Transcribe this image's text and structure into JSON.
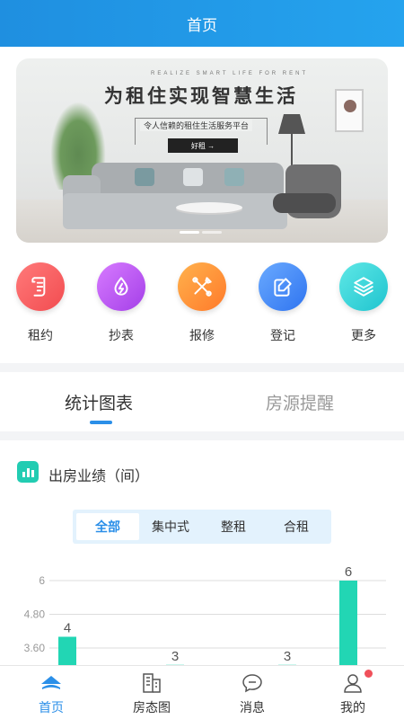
{
  "header": {
    "title": "首页"
  },
  "banner": {
    "small_caps": "REALIZE SMART LIFE FOR RENT",
    "title": "为租住实现智慧生活",
    "subtitle": "令人信赖的租住生活服务平台",
    "button_label": "好租 →"
  },
  "quick_actions": [
    {
      "label": "租约",
      "icon": "contract-icon",
      "color_from": "#ff7a7a",
      "color_to": "#f24c50"
    },
    {
      "label": "抄表",
      "icon": "meter-drop-icon",
      "color_from": "#d77bff",
      "color_to": "#a43fe8"
    },
    {
      "label": "报修",
      "icon": "repair-tools-icon",
      "color_from": "#ffb24d",
      "color_to": "#ff7a2a"
    },
    {
      "label": "登记",
      "icon": "register-edit-icon",
      "color_from": "#6aaaff",
      "color_to": "#2f74f0"
    },
    {
      "label": "更多",
      "icon": "layers-icon",
      "color_from": "#5fe8e6",
      "color_to": "#1fc4cf"
    }
  ],
  "tabs": [
    {
      "label": "统计图表",
      "active": true
    },
    {
      "label": "房源提醒",
      "active": false
    }
  ],
  "chart_section": {
    "title": "出房业绩（间）",
    "filters": [
      {
        "label": "全部",
        "active": true
      },
      {
        "label": "集中式",
        "active": false
      },
      {
        "label": "整租",
        "active": false
      },
      {
        "label": "合租",
        "active": false
      }
    ]
  },
  "chart_data": {
    "type": "bar",
    "title": "出房业绩（间）",
    "yticks": [
      "6",
      "4.80",
      "3.60"
    ],
    "ylim": [
      0,
      6
    ],
    "values": [
      4,
      3,
      3,
      6
    ],
    "value_labels": [
      "4",
      "3",
      "3",
      "6"
    ],
    "bar_color": "#22d6b4",
    "grid": true
  },
  "tabbar": [
    {
      "label": "首页",
      "icon": "home-icon",
      "active": true,
      "badge": false
    },
    {
      "label": "房态图",
      "icon": "building-icon",
      "active": false,
      "badge": false
    },
    {
      "label": "消息",
      "icon": "message-icon",
      "active": false,
      "badge": false
    },
    {
      "label": "我的",
      "icon": "user-icon",
      "active": false,
      "badge": true
    }
  ],
  "colors": {
    "accent": "#2b8fe8",
    "header": "#1f8fe0",
    "teal": "#22ccb2",
    "badge": "#f0505a"
  }
}
